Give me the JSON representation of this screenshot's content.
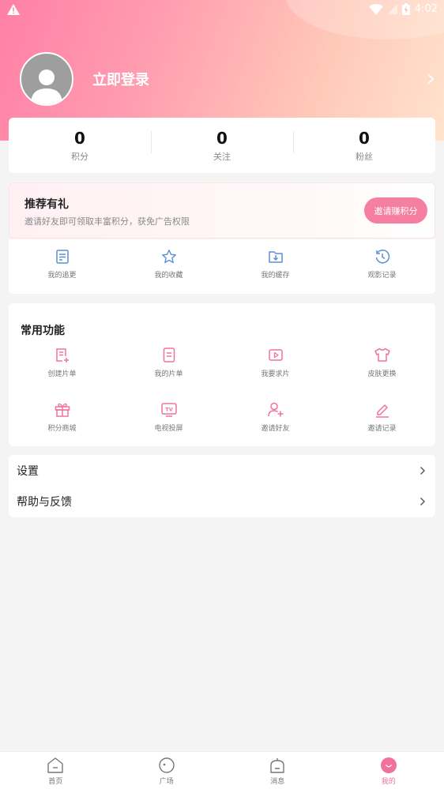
{
  "status_bar": {
    "time": "4:02"
  },
  "profile": {
    "login_text": "立即登录"
  },
  "stats": [
    {
      "value": "0",
      "label": "积分"
    },
    {
      "value": "0",
      "label": "关注"
    },
    {
      "value": "0",
      "label": "粉丝"
    }
  ],
  "referral": {
    "title": "推荐有礼",
    "description": "邀请好友即可领取丰富积分，获免广告权限",
    "button": "邀请赚积分"
  },
  "quick_items": [
    {
      "label": "我的追更",
      "icon": "follow-updates-icon"
    },
    {
      "label": "我的收藏",
      "icon": "star-icon"
    },
    {
      "label": "我的缓存",
      "icon": "download-folder-icon"
    },
    {
      "label": "观影记录",
      "icon": "history-icon"
    }
  ],
  "common": {
    "title": "常用功能",
    "items": [
      {
        "label": "创建片单",
        "icon": "create-list-icon"
      },
      {
        "label": "我的片单",
        "icon": "list-icon"
      },
      {
        "label": "我要求片",
        "icon": "play-request-icon"
      },
      {
        "label": "皮肤更换",
        "icon": "shirt-icon"
      },
      {
        "label": "积分商城",
        "icon": "gift-icon"
      },
      {
        "label": "电视投屏",
        "icon": "tv-icon"
      },
      {
        "label": "邀请好友",
        "icon": "add-user-icon"
      },
      {
        "label": "邀请记录",
        "icon": "edit-record-icon"
      }
    ]
  },
  "menu": [
    {
      "label": "设置"
    },
    {
      "label": "帮助与反馈"
    }
  ],
  "tabs": [
    {
      "label": "首页",
      "icon": "home-icon"
    },
    {
      "label": "广场",
      "icon": "square-icon"
    },
    {
      "label": "消息",
      "icon": "message-icon"
    },
    {
      "label": "我的",
      "icon": "me-icon",
      "active": true
    }
  ],
  "colors": {
    "accent": "#f47fa0",
    "blue_icon": "#5b8fd6",
    "pink_icon": "#f0729a"
  }
}
